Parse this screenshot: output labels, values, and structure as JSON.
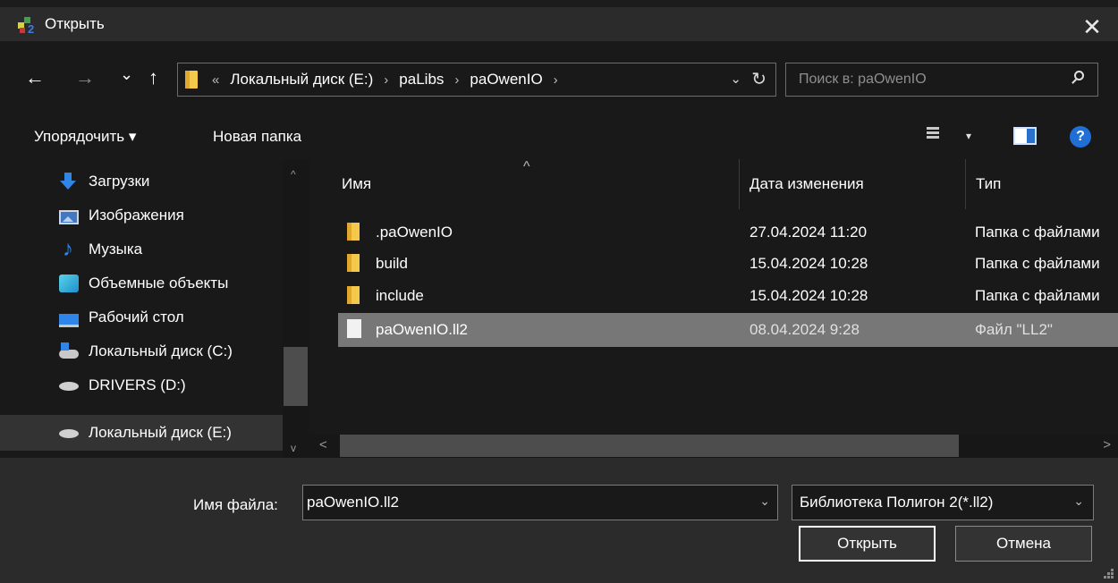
{
  "window": {
    "title": "Открыть"
  },
  "nav": {
    "back": "←",
    "forward": "→",
    "recent": "⌄",
    "up": "↑",
    "overflow": "«",
    "breadcrumbs": [
      "Локальный диск (E:)",
      "paLibs",
      "paOwenIO"
    ],
    "crumb_separator": "›",
    "dropdown": "⌄",
    "refresh": "↻",
    "search_placeholder": "Поиск в: paOwenIO"
  },
  "toolbar": {
    "organize": "Упорядочить ▾",
    "new_folder": "Новая папка",
    "view_dropdown": "▾",
    "help": "?"
  },
  "sidebar": {
    "items": [
      {
        "label": "Загрузки",
        "icon": "download-icon"
      },
      {
        "label": "Изображения",
        "icon": "pictures-icon"
      },
      {
        "label": "Музыка",
        "icon": "music-icon"
      },
      {
        "label": "Объемные объекты",
        "icon": "3d-objects-icon"
      },
      {
        "label": "Рабочий стол",
        "icon": "desktop-icon"
      },
      {
        "label": "Локальный диск (C:)",
        "icon": "windows-drive-icon"
      },
      {
        "label": "DRIVERS (D:)",
        "icon": "drive-icon"
      },
      {
        "label": "Локальный диск (E:)",
        "icon": "drive-icon"
      }
    ]
  },
  "files": {
    "columns": [
      "Имя",
      "Дата изменения",
      "Тип"
    ],
    "rows": [
      {
        "name": ".paOwenIO",
        "date": "27.04.2024 11:20",
        "type": "Папка с файлами",
        "kind": "folder"
      },
      {
        "name": "build",
        "date": "15.04.2024 10:28",
        "type": "Папка с файлами",
        "kind": "folder"
      },
      {
        "name": "include",
        "date": "15.04.2024 10:28",
        "type": "Папка с файлами",
        "kind": "folder"
      },
      {
        "name": "paOwenIO.ll2",
        "date": "08.04.2024 9:28",
        "type": "Файл \"LL2\"",
        "kind": "file"
      }
    ]
  },
  "bottom": {
    "filename_label": "Имя файла:",
    "filename_value": "paOwenIO.ll2",
    "filter_value": "Библиотека Полигон 2(*.ll2)",
    "open_button": "Открыть",
    "cancel_button": "Отмена"
  },
  "colors": {
    "background": "#202020",
    "selection": "#777777",
    "accent": "#2f86e8",
    "folder": "#f4c84a"
  }
}
